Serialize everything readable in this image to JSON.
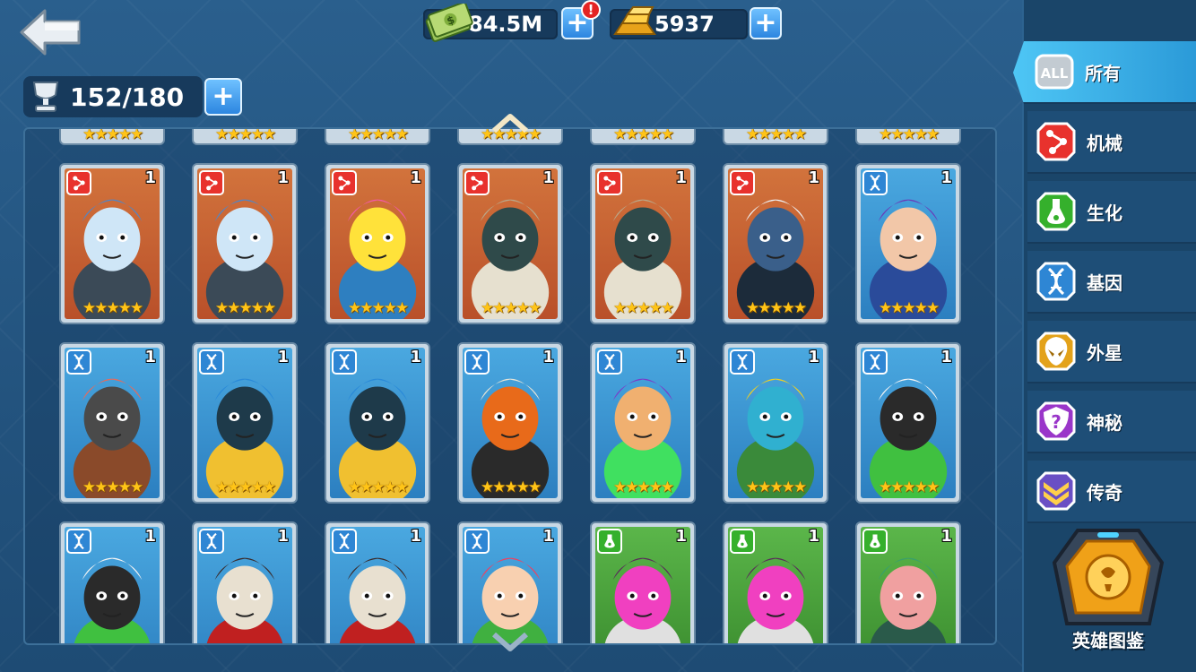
{
  "header": {
    "cash": "84.5M",
    "cash_alert": "!",
    "gold": "5937",
    "capacity": "152/180",
    "plus": "+"
  },
  "sidebar": {
    "items": [
      {
        "key": "all",
        "icon_text": "ALL",
        "label": "所有",
        "color": "#9aa3ab"
      },
      {
        "key": "mech",
        "label": "机械",
        "color": "#e8322d"
      },
      {
        "key": "bio",
        "label": "生化",
        "color": "#35b02c"
      },
      {
        "key": "gene",
        "label": "基因",
        "color": "#2e86d4"
      },
      {
        "key": "alien",
        "label": "外星",
        "color": "#e3a21a"
      },
      {
        "key": "mystic",
        "label": "神秘",
        "color": "#9a36c9"
      },
      {
        "key": "legend",
        "label": "传奇",
        "color": "#6a4fc4"
      }
    ],
    "codex_label": "英雄图鉴"
  },
  "cards": {
    "rows": [
      [
        {
          "type": "mech",
          "level": "1",
          "stars": "★★★★★",
          "hero": "blue-tank-brute"
        },
        {
          "type": "mech",
          "level": "1",
          "stars": "★★★★★",
          "hero": "blue-tank-brute"
        },
        {
          "type": "mech",
          "level": "1",
          "stars": "★★★★★",
          "hero": "pink-hair-goggles-girl"
        },
        {
          "type": "mech",
          "level": "1",
          "stars": "★★★★★",
          "hero": "stone-golem"
        },
        {
          "type": "mech",
          "level": "1",
          "stars": "★★★★★",
          "hero": "stone-golem"
        },
        {
          "type": "mech",
          "level": "1",
          "stars": "★★★★★",
          "hero": "white-robot"
        },
        {
          "type": "gene",
          "level": "1",
          "stars": "★★★★★",
          "hero": "purple-hair-fighter"
        }
      ],
      [
        {
          "type": "gene",
          "level": "1",
          "stars": "★★★★★",
          "hero": "bearded-red-eye"
        },
        {
          "type": "gene",
          "level": "1",
          "stars": "★★★★★",
          "hero": "blue-helmet-brute"
        },
        {
          "type": "gene",
          "level": "1",
          "stars": "★★★★★",
          "hero": "blue-helmet-brute"
        },
        {
          "type": "gene",
          "level": "1",
          "stars": "★★★★★",
          "hero": "pumpkin-scarecrow"
        },
        {
          "type": "gene",
          "level": "1",
          "stars": "★★★★★",
          "hero": "green-goggles-hero"
        },
        {
          "type": "gene",
          "level": "1",
          "stars": "★★★★★",
          "hero": "yellow-robot-scorpion"
        },
        {
          "type": "gene",
          "level": "1",
          "stars": "★★★★★",
          "hero": "panda-fighter"
        }
      ],
      [
        {
          "type": "gene",
          "level": "1",
          "stars": "",
          "hero": "panda-fighter"
        },
        {
          "type": "gene",
          "level": "1",
          "stars": "",
          "hero": "skull-hood"
        },
        {
          "type": "gene",
          "level": "1",
          "stars": "",
          "hero": "skull-hood"
        },
        {
          "type": "gene",
          "level": "1",
          "stars": "",
          "hero": "red-hair-girl"
        },
        {
          "type": "bio",
          "level": "1",
          "stars": "",
          "hero": "gorilla-brute"
        },
        {
          "type": "bio",
          "level": "1",
          "stars": "",
          "hero": "gorilla-brute"
        },
        {
          "type": "bio",
          "level": "1",
          "stars": "",
          "hero": "masked-zombie"
        }
      ]
    ],
    "partial_row_stars": "★★★★★"
  }
}
